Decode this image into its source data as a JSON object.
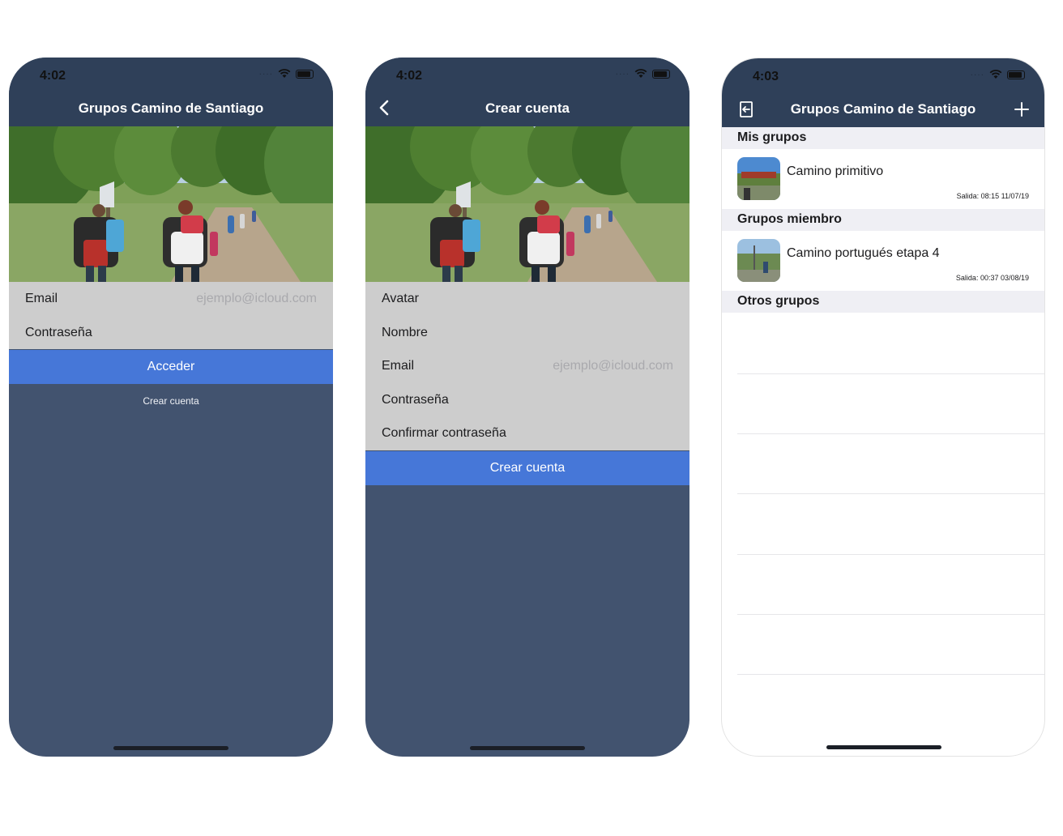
{
  "screen1": {
    "status_time": "4:02",
    "nav_title": "Grupos Camino de Santiago",
    "form": {
      "email_label": "Email",
      "email_placeholder": "ejemplo@icloud.com",
      "password_label": "Contraseña"
    },
    "login_button": "Acceder",
    "create_account_link": "Crear cuenta"
  },
  "screen2": {
    "status_time": "4:02",
    "nav_title": "Crear cuenta",
    "form": {
      "avatar_label": "Avatar",
      "name_label": "Nombre",
      "email_label": "Email",
      "email_placeholder": "ejemplo@icloud.com",
      "password_label": "Contraseña",
      "confirm_password_label": "Confirmar contraseña"
    },
    "create_button": "Crear cuenta"
  },
  "screen3": {
    "status_time": "4:03",
    "nav_title": "Grupos Camino de Santiago",
    "sections": {
      "mine": {
        "title": "Mis grupos",
        "items": [
          {
            "name": "Camino primitivo",
            "departure": "Salida: 08:15 11/07/19"
          }
        ]
      },
      "member": {
        "title": "Grupos miembro",
        "items": [
          {
            "name": "Camino portugués etapa 4",
            "departure": "Salida: 00:37 03/08/19"
          }
        ]
      },
      "others": {
        "title": "Otros grupos",
        "items": []
      }
    }
  },
  "colors": {
    "nav_bar": "#2f4059",
    "background": "#42536f",
    "form_background": "#cdcdcd",
    "primary_button": "#4677d8",
    "section_header": "#efeff4"
  },
  "icons": {
    "back": "chevron-left-icon",
    "logout": "logout-icon",
    "add": "plus-icon",
    "wifi": "wifi-icon",
    "battery": "battery-icon"
  }
}
